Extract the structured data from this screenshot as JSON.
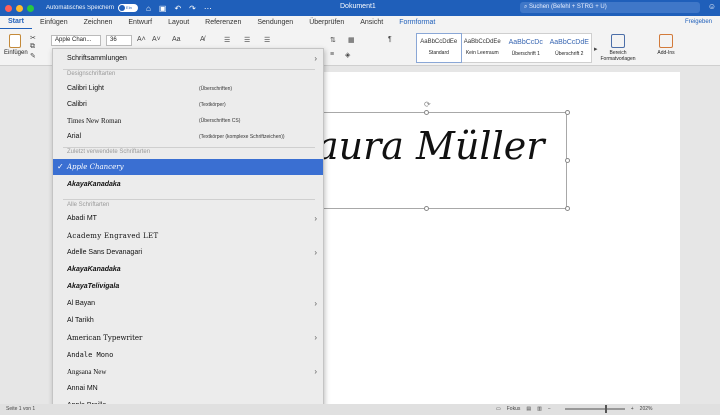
{
  "titlebar": {
    "autosave_label": "Automatisches Speichern",
    "autosave_state": "Ein",
    "document_title": "Dokument1",
    "search_placeholder": "Suchen (Befehl + STRG + U)"
  },
  "ribbon_tabs": [
    {
      "label": "Start",
      "active": true
    },
    {
      "label": "Einfügen"
    },
    {
      "label": "Zeichnen"
    },
    {
      "label": "Entwurf"
    },
    {
      "label": "Layout"
    },
    {
      "label": "Referenzen"
    },
    {
      "label": "Sendungen"
    },
    {
      "label": "Überprüfen"
    },
    {
      "label": "Ansicht"
    },
    {
      "label": "Formformat",
      "accent": true
    }
  ],
  "share_label": "Freigeben",
  "ribbon": {
    "paste_label": "Einfügen",
    "font_value": "Apple Chan...",
    "size_value": "36",
    "styles": [
      {
        "preview": "AaBbCcDdEe",
        "name": "Standard"
      },
      {
        "preview": "AaBbCcDdEe",
        "name": "Kein Leerraum"
      },
      {
        "preview": "AaBbCcDc",
        "name": "Überschrift 1"
      },
      {
        "preview": "AaBbCcDdE",
        "name": "Überschrift 2"
      }
    ],
    "styles_pane_label": "Bereich Formatvorlagen",
    "addins_label": "Add-Ins"
  },
  "document": {
    "text": "aura Müller"
  },
  "font_menu": {
    "theme_item": "Schriftsammlungen",
    "theme_header": "Designschriftarten",
    "theme_fonts": [
      {
        "name": "Calibri Light",
        "note": "(Überschriften)"
      },
      {
        "name": "Calibri",
        "note": "(Textkörper)"
      },
      {
        "name": "Times New Roman",
        "note": "(Überschriften CS)"
      },
      {
        "name": "Arial",
        "note": "(Textkörper (komplexe Schriftzeichen))"
      }
    ],
    "recent_header": "Zuletzt verwendete Schriftarten",
    "recent_fonts": [
      "Apple Chancery",
      "AkayaKanadaka"
    ],
    "all_header": "Alle Schriftarten",
    "all_fonts": [
      {
        "name": "Abadi MT",
        "submenu": true
      },
      {
        "name": "Academy Engraved LET",
        "submenu": false
      },
      {
        "name": "Adelle Sans Devanagari",
        "submenu": true
      },
      {
        "name": "AkayaKanadaka",
        "submenu": false
      },
      {
        "name": "AkayaTelivigala",
        "submenu": false
      },
      {
        "name": "Al Bayan",
        "submenu": true
      },
      {
        "name": "Al Tarikh",
        "submenu": false
      },
      {
        "name": "American Typewriter",
        "submenu": true
      },
      {
        "name": "Andale Mono",
        "submenu": false
      },
      {
        "name": "Angsana New",
        "submenu": true
      },
      {
        "name": "Annai MN",
        "submenu": false
      },
      {
        "name": "Apple Braille",
        "submenu": true
      }
    ]
  },
  "statusbar": {
    "page_info": "Seite 1 von 1",
    "focus_label": "Fokus",
    "zoom": "202%"
  }
}
